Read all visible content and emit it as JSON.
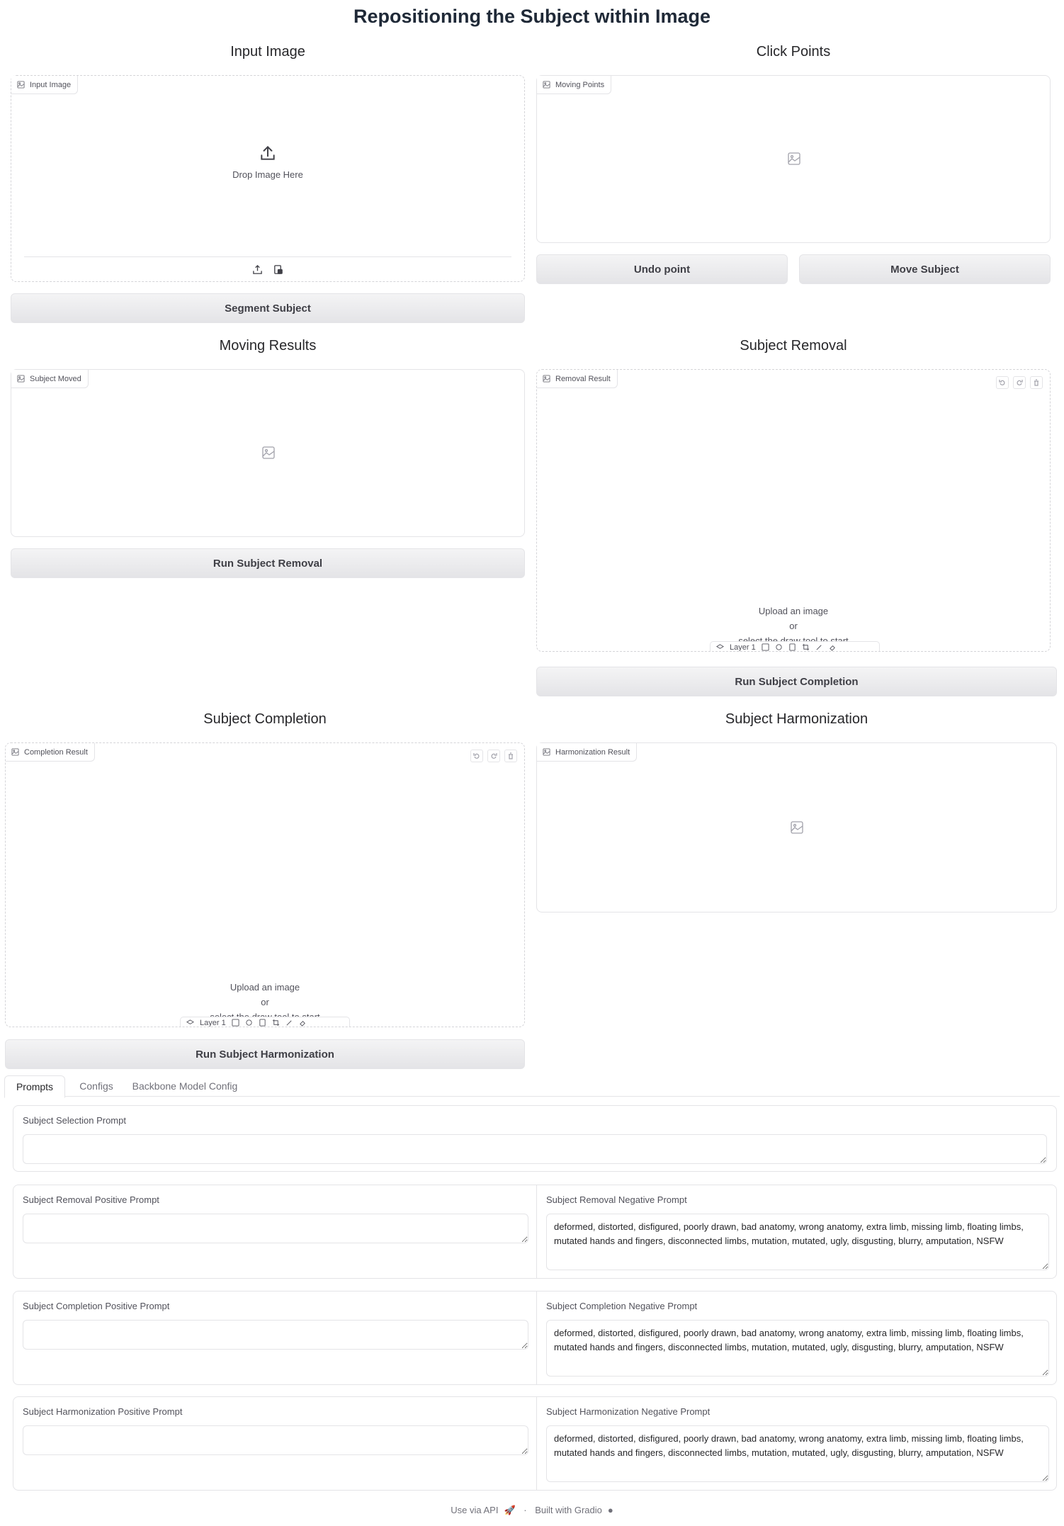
{
  "page": {
    "title": "Repositioning the Subject within Image"
  },
  "input_image": {
    "section_title": "Input Image",
    "label": "Input Image",
    "drop_text": "Drop Image Here",
    "upload_icon": "upload-icon",
    "paste_icon": "clipboard-image-icon",
    "segment_button": "Segment Subject"
  },
  "click_points": {
    "section_title": "Click Points",
    "label": "Moving Points",
    "placeholder_icon": "image-icon",
    "undo_button": "Undo point",
    "move_button": "Move Subject"
  },
  "moving_results": {
    "section_title": "Moving Results",
    "label": "Subject Moved",
    "placeholder_icon": "image-icon",
    "run_button": "Run Subject Removal"
  },
  "subject_removal": {
    "section_title": "Subject Removal",
    "label": "Removal Result",
    "upload_line1": "Upload an image",
    "upload_line2": "or",
    "upload_line3": "select the draw tool to start",
    "layer_label": "Layer 1",
    "run_button": "Run Subject Completion"
  },
  "subject_completion": {
    "section_title": "Subject Completion",
    "label": "Completion Result",
    "upload_line1": "Upload an image",
    "upload_line2": "or",
    "upload_line3": "select the draw tool to start",
    "layer_label": "Layer 1",
    "run_button": "Run Subject Harmonization"
  },
  "subject_harmonization": {
    "section_title": "Subject Harmonization",
    "label": "Harmonization Result",
    "placeholder_icon": "image-icon"
  },
  "tabs": [
    "Prompts",
    "Configs",
    "Backbone Model Config"
  ],
  "active_tab": "Prompts",
  "prompts": {
    "selection": {
      "label": "Subject Selection Prompt",
      "value": ""
    },
    "removal_positive": {
      "label": "Subject Removal Positive Prompt",
      "value": ""
    },
    "removal_negative": {
      "label": "Subject Removal Negative Prompt",
      "value": "deformed, distorted, disfigured, poorly drawn, bad anatomy, wrong anatomy, extra limb, missing limb, floating limbs, mutated hands and fingers, disconnected limbs, mutation, mutated, ugly, disgusting, blurry, amputation, NSFW"
    },
    "completion_positive": {
      "label": "Subject Completion Positive Prompt",
      "value": ""
    },
    "completion_negative": {
      "label": "Subject Completion Negative Prompt",
      "value": "deformed, distorted, disfigured, poorly drawn, bad anatomy, wrong anatomy, extra limb, missing limb, floating limbs, mutated hands and fingers, disconnected limbs, mutation, mutated, ugly, disgusting, blurry, amputation, NSFW"
    },
    "harmonization_positive": {
      "label": "Subject Harmonization Positive Prompt",
      "value": ""
    },
    "harmonization_negative": {
      "label": "Subject Harmonization Negative Prompt",
      "value": "deformed, distorted, disfigured, poorly drawn, bad anatomy, wrong anatomy, extra limb, missing limb, floating limbs, mutated hands and fingers, disconnected limbs, mutation, mutated, ugly, disgusting, blurry, amputation, NSFW"
    }
  },
  "footer": {
    "api": "Use via API",
    "separator": "·",
    "built": "Built with Gradio"
  }
}
